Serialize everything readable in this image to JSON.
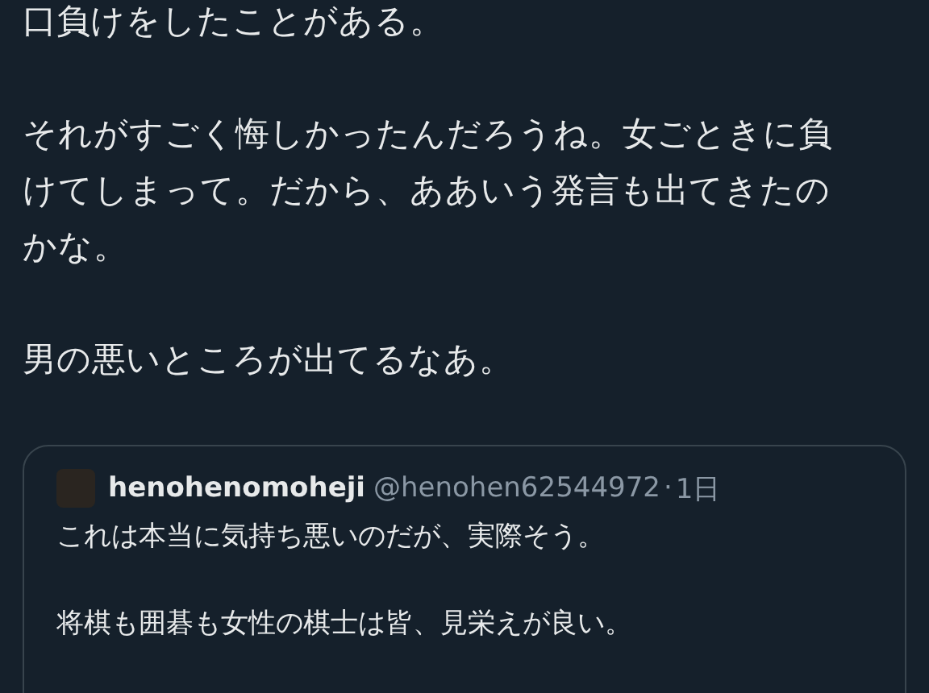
{
  "tweet": {
    "paragraphs": [
      {
        "lines": [
          "口負けをしたことがある。"
        ]
      },
      {
        "lines": [
          "それがすごく悔しかったんだろうね。女ごときに負",
          "けてしまって。だから、ああいう発言も出てきたの",
          "かな。"
        ]
      },
      {
        "lines": [
          "男の悪いところが出てるなあ。"
        ]
      }
    ]
  },
  "quoted_tweet": {
    "display_name": "henohenomoheji",
    "handle": "@henohen62544972",
    "separator": "·",
    "time": "1日",
    "paragraphs": [
      {
        "lines": [
          "これは本当に気持ち悪いのだが、実際そう。"
        ]
      },
      {
        "lines": [
          "将棋も囲碁も女性の棋士は皆、見栄えが良い。"
        ]
      }
    ]
  }
}
